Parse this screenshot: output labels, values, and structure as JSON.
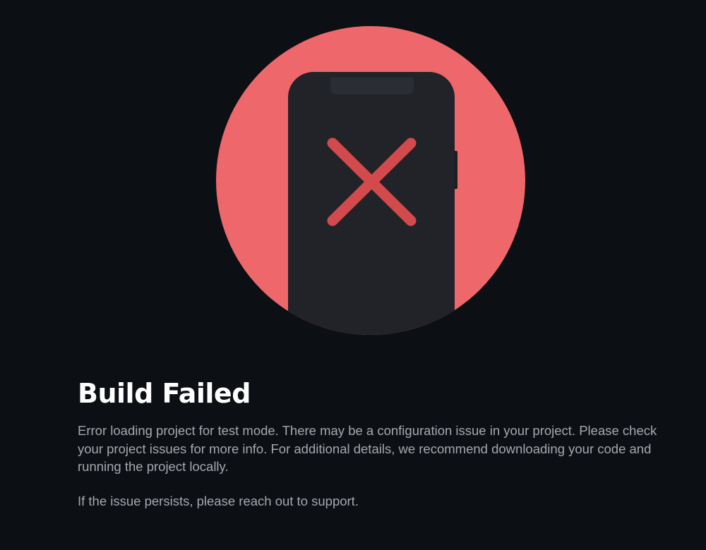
{
  "illustration": {
    "icon": "phone-error-icon",
    "circle_color": "#ee676b",
    "phone_color": "#212328",
    "phone_notch_color": "#2a2d33",
    "x_mark_color": "#d24a4b"
  },
  "error": {
    "title": "Build Failed",
    "description": "Error loading project for test mode. There may be a configuration issue in your project. Please check your project issues for more info. For additional details, we recommend downloading your code and running the project locally.",
    "support_note": "If the issue persists, please reach out to support."
  }
}
